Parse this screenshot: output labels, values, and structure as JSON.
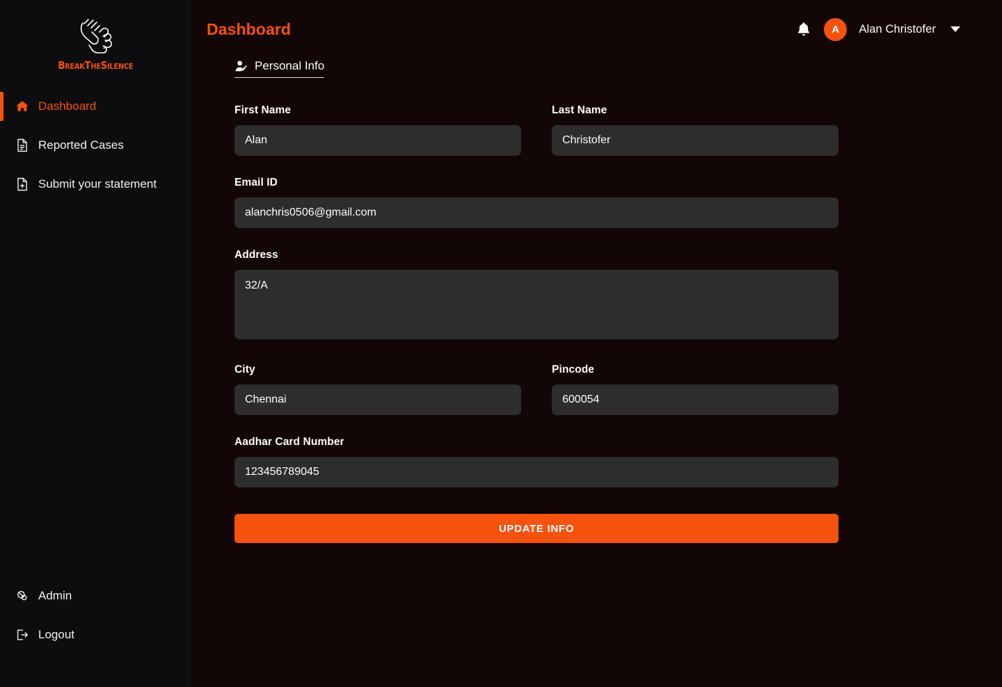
{
  "sidebar": {
    "brand": {
      "name": "BreakTheSilence",
      "logo_icon": "signing-hands-icon"
    },
    "top_items": [
      {
        "label": "Dashboard",
        "icon": "home-icon",
        "active": true
      },
      {
        "label": "Reported Cases",
        "icon": "document-lines-icon",
        "active": false
      },
      {
        "label": "Submit your statement",
        "icon": "document-plus-icon",
        "active": false
      }
    ],
    "bottom_items": [
      {
        "label": "Admin",
        "icon": "admin-user-icon"
      },
      {
        "label": "Logout",
        "icon": "logout-arrow-icon"
      }
    ]
  },
  "header": {
    "title": "Dashboard",
    "bell_icon": "notification-bell-icon",
    "avatar_initial": "A",
    "user_name": "Alan Christofer",
    "caret_icon": "chevron-down-icon"
  },
  "tabs": [
    {
      "label": "Personal Info",
      "icon": "user-edit-icon",
      "active": true
    }
  ],
  "form": {
    "first_name": {
      "label": "First Name",
      "value": "Alan",
      "placeholder": "First Name"
    },
    "last_name": {
      "label": "Last Name",
      "value": "Christofer",
      "placeholder": "Last Name"
    },
    "email": {
      "label": "Email ID",
      "value": "alanchris0506@gmail.com",
      "placeholder": "Email ID"
    },
    "address": {
      "label": "Address",
      "value": "32/A",
      "placeholder": "Address"
    },
    "city": {
      "label": "City",
      "value": "Chennai",
      "placeholder": "City"
    },
    "pincode": {
      "label": "Pincode",
      "value": "600054",
      "placeholder": "Pincode"
    },
    "aadhar": {
      "label": "Aadhar Card Number",
      "value": "123456789045",
      "placeholder": "Aadhar Card Number"
    },
    "submit_label": "UPDATE INFO"
  },
  "colors": {
    "accent": "#f4520f",
    "sidebar_bg": "#0d0d0f",
    "main_bg": "#120606",
    "input_bg": "#2d2d2d"
  }
}
